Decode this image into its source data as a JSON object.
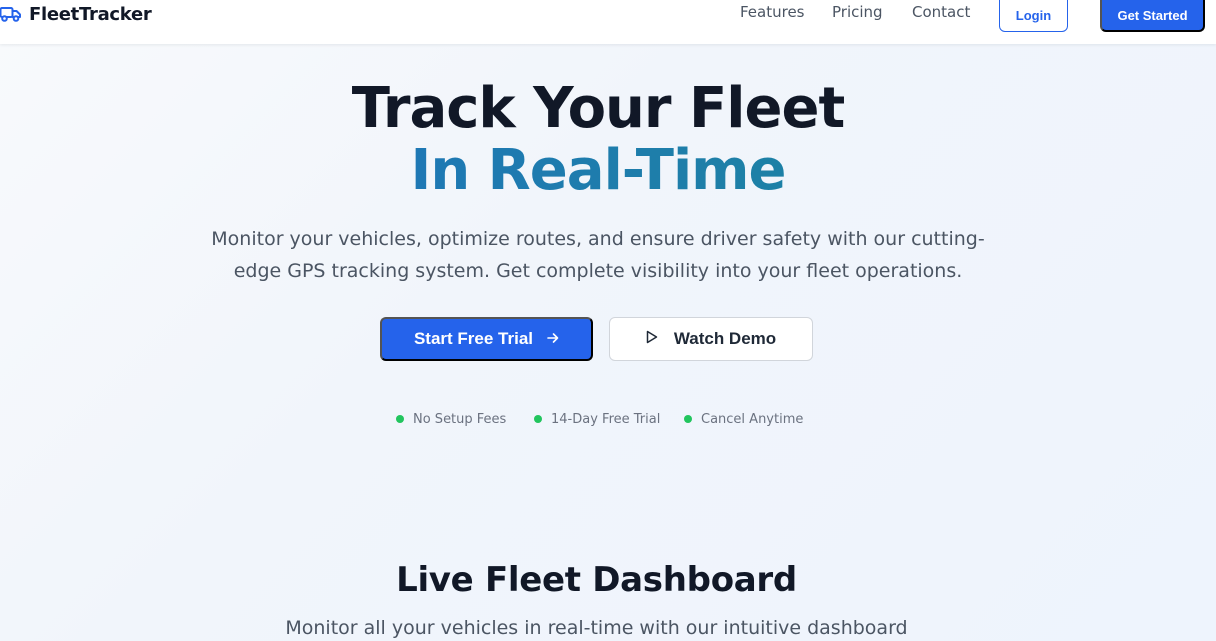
{
  "brand": {
    "name": "FleetTracker",
    "icon": "truck-icon",
    "accent_color": "#2563eb"
  },
  "nav": {
    "links": [
      "Features",
      "Pricing",
      "Contact"
    ],
    "login_label": "Login",
    "get_started_label": "Get Started"
  },
  "hero": {
    "title_line1": "Track Your Fleet",
    "title_line2": "In Real-Time",
    "subtitle": "Monitor your vehicles, optimize routes, and ensure driver safety with our cutting-edge GPS tracking system. Get complete visibility into your fleet operations.",
    "primary_cta": "Start Free Trial",
    "primary_cta_icon": "arrow-right-icon",
    "secondary_cta": "Watch Demo",
    "secondary_cta_icon": "play-icon",
    "features": [
      "No Setup Fees",
      "14-Day Free Trial",
      "Cancel Anytime"
    ],
    "feature_dot_color": "#22c55e"
  },
  "dashboard_section": {
    "title": "Live Fleet Dashboard",
    "subtitle": "Monitor all your vehicles in real-time with our intuitive dashboard"
  }
}
